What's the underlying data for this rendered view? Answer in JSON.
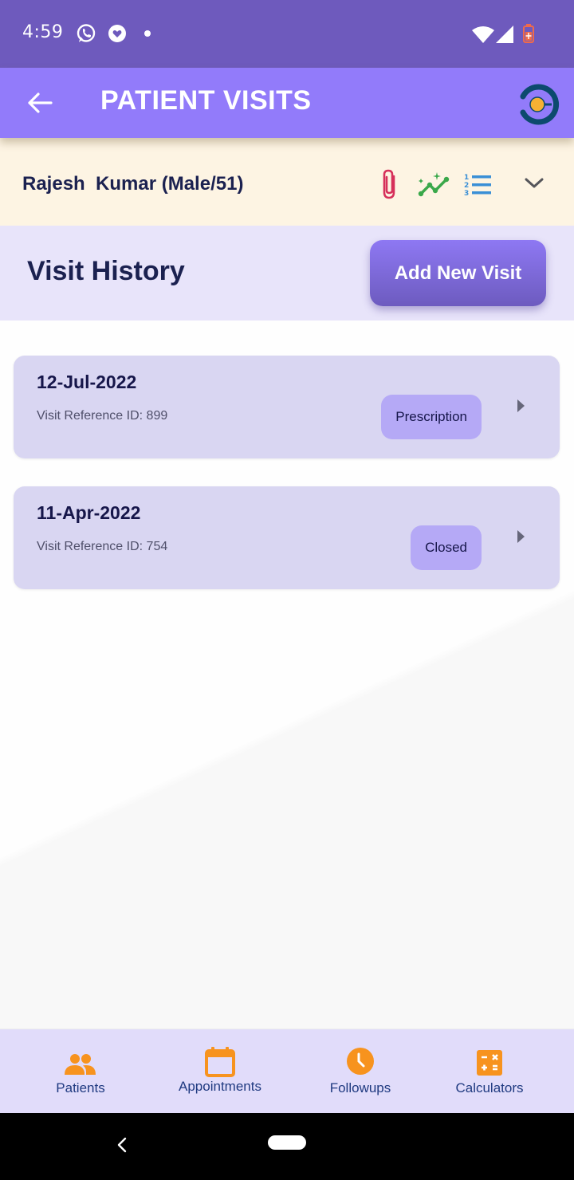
{
  "status_bar": {
    "time": "4:59",
    "icons": [
      "whatsapp-icon",
      "heart-notification-icon",
      "dot-icon",
      "wifi-icon",
      "signal-icon",
      "battery-charging-icon"
    ],
    "battery_color": "#f06a4a"
  },
  "app_bar": {
    "title": "PATIENT VISITS",
    "back_icon": "arrow-left-icon",
    "logo": "app-logo",
    "background": "#927bfa"
  },
  "patient": {
    "name": "Rajesh  Kumar (Male/51)",
    "actions": [
      {
        "icon": "paperclip-icon",
        "color": "#d62f5a"
      },
      {
        "icon": "trend-sparkle-icon",
        "color": "#3aa84a"
      },
      {
        "icon": "numbered-list-icon",
        "color": "#3a8fd6"
      },
      {
        "icon": "chevron-down-icon",
        "color": "#55555a"
      }
    ]
  },
  "visit_history": {
    "title": "Visit History",
    "add_button_label": "Add New Visit"
  },
  "visits": [
    {
      "date": "12-Jul-2022",
      "reference": "Visit Reference ID: 899",
      "status": "Prescription"
    },
    {
      "date": "11-Apr-2022",
      "reference": "Visit Reference ID: 754",
      "status": "Closed"
    }
  ],
  "bottom_nav": {
    "items": [
      {
        "label": "Patients",
        "icon": "people-icon"
      },
      {
        "label": "Appointments",
        "icon": "calendar-icon"
      },
      {
        "label": "Followups",
        "icon": "clock-icon"
      },
      {
        "label": "Calculators",
        "icon": "calculator-icon"
      }
    ],
    "icon_color": "#f7931e"
  },
  "system_nav": {
    "back": "system-back-icon",
    "home": "home-pill"
  }
}
